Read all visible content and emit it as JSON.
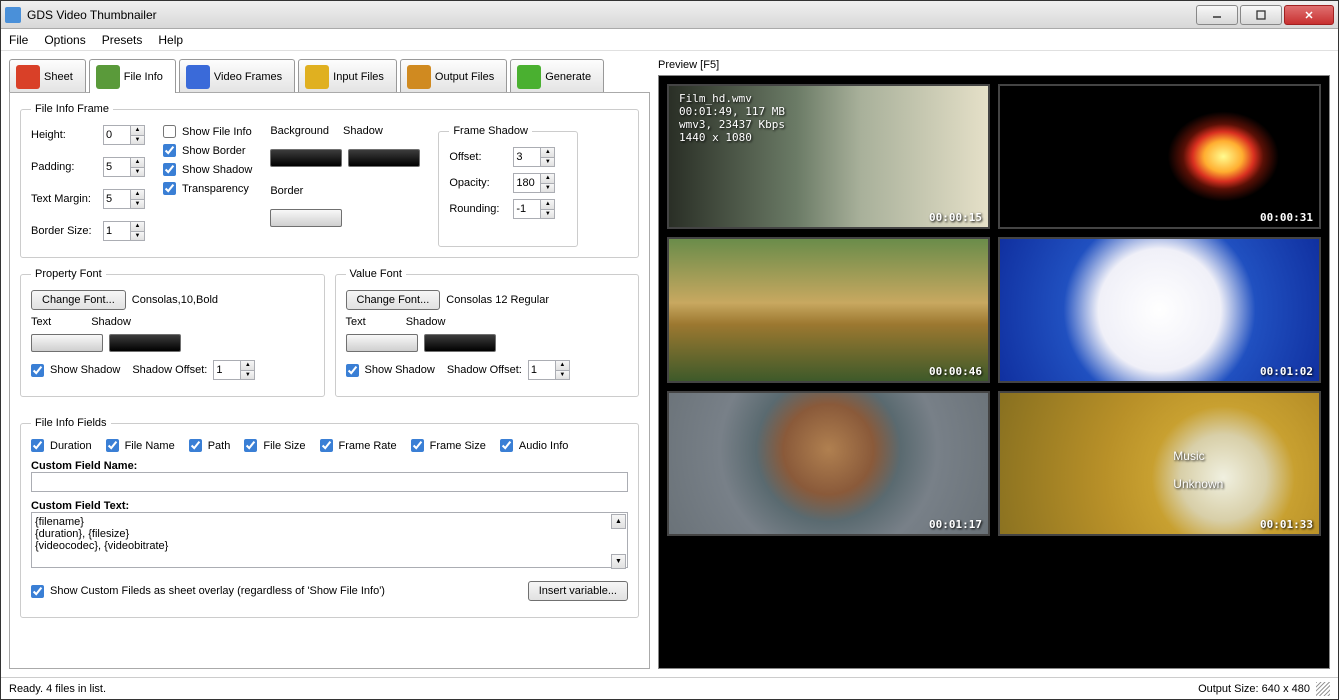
{
  "title": "GDS Video Thumbnailer",
  "menu": [
    "File",
    "Options",
    "Presets",
    "Help"
  ],
  "tabs": [
    {
      "label": "Sheet",
      "color": "#d94028"
    },
    {
      "label": "File Info",
      "color": "#5a9a3a"
    },
    {
      "label": "Video Frames",
      "color": "#3a6ad9"
    },
    {
      "label": "Input Files",
      "color": "#e0b020"
    },
    {
      "label": "Output Files",
      "color": "#d08a20"
    },
    {
      "label": "Generate",
      "color": "#4ab030"
    }
  ],
  "active_tab": 1,
  "fif": {
    "legend": "File Info Frame",
    "height": {
      "label": "Height:",
      "value": "0"
    },
    "padding": {
      "label": "Padding:",
      "value": "5"
    },
    "margin": {
      "label": "Text Margin:",
      "value": "5"
    },
    "border": {
      "label": "Border Size:",
      "value": "1"
    },
    "show_info": {
      "label": "Show File Info",
      "checked": false
    },
    "show_border": {
      "label": "Show Border",
      "checked": true
    },
    "show_shadow": {
      "label": "Show Shadow",
      "checked": true
    },
    "transparency": {
      "label": "Transparency",
      "checked": true
    },
    "bg_label": "Background",
    "sh_label": "Shadow",
    "bd_label": "Border"
  },
  "fs": {
    "legend": "Frame Shadow",
    "offset": {
      "label": "Offset:",
      "value": "3"
    },
    "opacity": {
      "label": "Opacity:",
      "value": "180"
    },
    "rounding": {
      "label": "Rounding:",
      "value": "-1"
    }
  },
  "pfont": {
    "legend": "Property Font",
    "btn": "Change Font...",
    "desc": "Consolas,10,Bold",
    "text": "Text",
    "shadow": "Shadow",
    "chk": "Show Shadow",
    "off": "Shadow Offset:",
    "offv": "1"
  },
  "vfont": {
    "legend": "Value Font",
    "btn": "Change Font...",
    "desc": "Consolas 12 Regular",
    "text": "Text",
    "shadow": "Shadow",
    "chk": "Show Shadow",
    "off": "Shadow Offset:",
    "offv": "1"
  },
  "fields": {
    "legend": "File Info Fields",
    "items": [
      "Duration",
      "File Name",
      "Path",
      "File Size",
      "Frame Rate",
      "Frame Size",
      "Audio Info"
    ],
    "custom_name_label": "Custom Field Name:",
    "custom_name": "",
    "custom_text_label": "Custom Field Text:",
    "custom_text": "{filename}\n{duration}, {filesize}\n{videocodec}, {videobitrate}",
    "overlay_chk": "Show Custom Fileds as sheet overlay (regardless of 'Show File Info')",
    "insert_btn": "Insert variable..."
  },
  "preview": {
    "label": "Preview  [F5]",
    "info": "Film_hd.wmv\n00:01:49, 117 MB\nwmv3, 23437 Kbps\n1440 x 1080",
    "thumbs": [
      {
        "cls": "t1",
        "ts": "00:00:15",
        "overlay": true
      },
      {
        "cls": "t2",
        "ts": "00:00:31"
      },
      {
        "cls": "t3",
        "ts": "00:00:46"
      },
      {
        "cls": "t4",
        "ts": "00:01:02"
      },
      {
        "cls": "t5",
        "ts": "00:01:17"
      },
      {
        "cls": "t6",
        "ts": "00:01:33",
        "center": "Music\n\nUnknown"
      }
    ]
  },
  "status": {
    "left": "Ready. 4 files in list.",
    "right": "Output Size: 640 x 480"
  }
}
